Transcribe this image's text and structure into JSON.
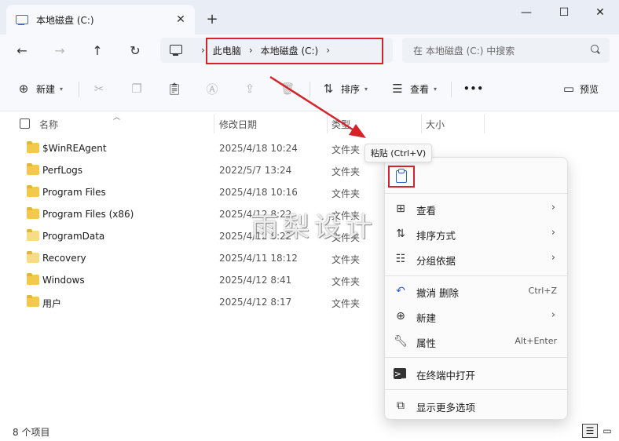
{
  "window": {
    "tab_title": "本地磁盘 (C:)",
    "tab_close": "✕",
    "new_tab": "+",
    "minimize": "—",
    "maximize": "☐",
    "close": "✕"
  },
  "nav": {
    "back": "←",
    "forward": "→",
    "up": "↑",
    "refresh": "↻"
  },
  "breadcrumb": {
    "items": [
      "此电脑",
      "本地磁盘 (C:)"
    ],
    "separator": "›"
  },
  "search": {
    "placeholder": "在 本地磁盘 (C:) 中搜索"
  },
  "toolbar": {
    "new_label": "新建",
    "sort_label": "排序",
    "view_label": "查看",
    "more_label": "•••",
    "preview_label": "预览"
  },
  "columns": {
    "name": "名称",
    "date": "修改日期",
    "type": "类型",
    "size": "大小"
  },
  "files": [
    {
      "name": "$WinREAgent",
      "date": "2025/4/18 10:24",
      "type": "文件夹"
    },
    {
      "name": "PerfLogs",
      "date": "2022/5/7 13:24",
      "type": "文件夹"
    },
    {
      "name": "Program Files",
      "date": "2025/4/18 10:16",
      "type": "文件夹"
    },
    {
      "name": "Program Files (x86)",
      "date": "2025/4/12 8:22",
      "type": "文件夹"
    },
    {
      "name": "ProgramData",
      "date": "2025/4/12 8:22",
      "type": "文件夹"
    },
    {
      "name": "Recovery",
      "date": "2025/4/11 18:12",
      "type": "文件夹"
    },
    {
      "name": "Windows",
      "date": "2025/4/12 8:41",
      "type": "文件夹"
    },
    {
      "name": "用户",
      "date": "2025/4/12 8:17",
      "type": "文件夹"
    }
  ],
  "tooltip": {
    "text": "粘贴 (Ctrl+V)"
  },
  "context_menu": {
    "view": "查看",
    "sort": "排序方式",
    "group": "分组依据",
    "undo": "撤消 删除",
    "undo_shortcut": "Ctrl+Z",
    "new": "新建",
    "properties": "属性",
    "properties_shortcut": "Alt+Enter",
    "terminal": "在终端中打开",
    "more_options": "显示更多选项"
  },
  "watermark": "雨梨设计",
  "status": {
    "item_count": "8 个项目"
  },
  "colors": {
    "accent": "#2c62c9",
    "annotation_red": "#d6232a",
    "folder": "#f2c94c"
  }
}
